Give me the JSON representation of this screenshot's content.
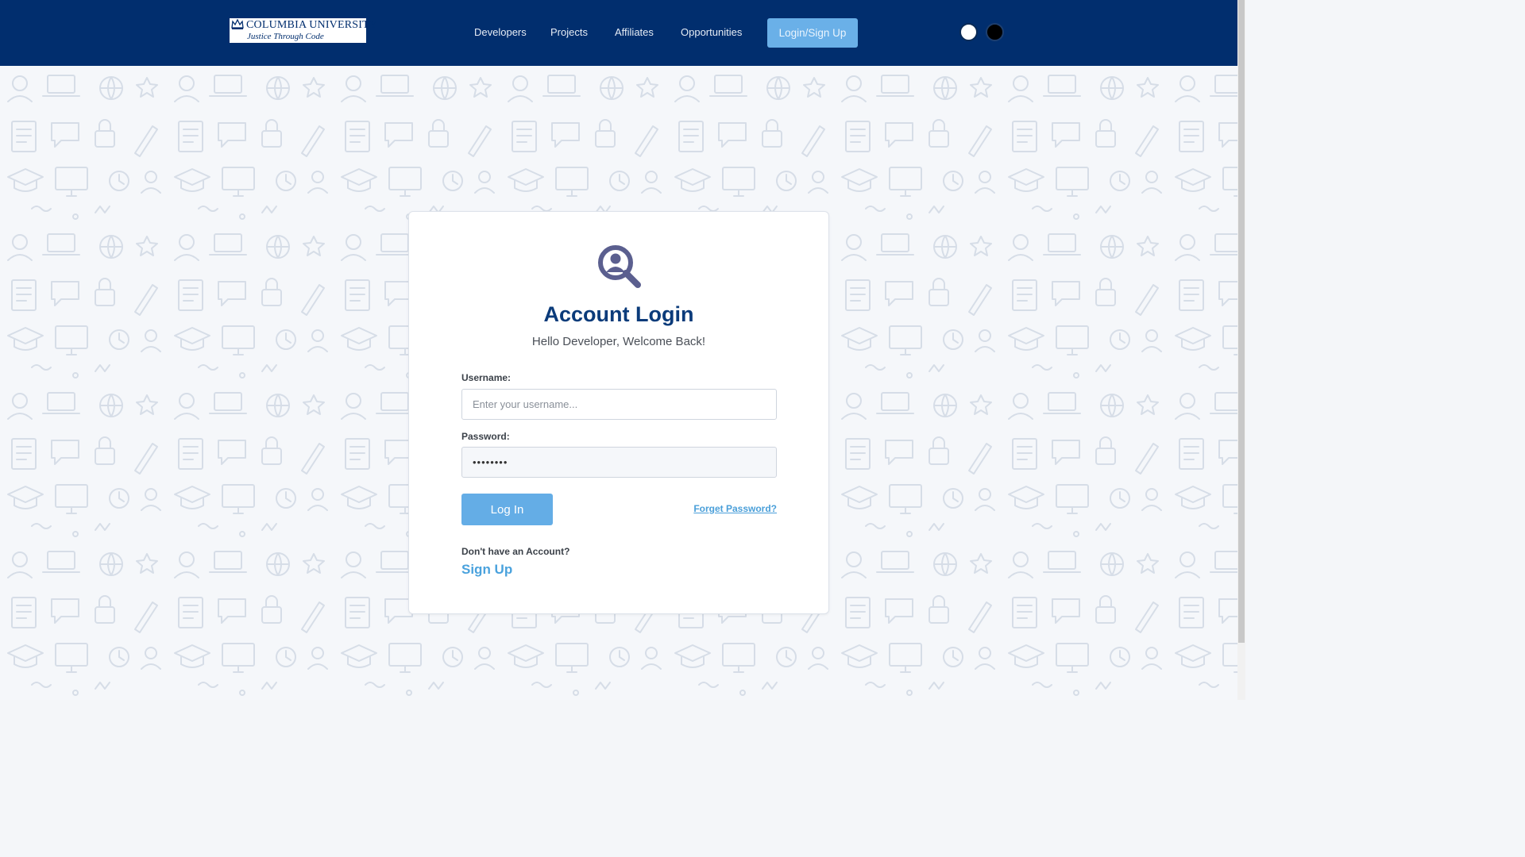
{
  "header": {
    "logo": {
      "line1": "COLUMBIA UNIVERSITY",
      "line2": "Justice Through Code",
      "icon": "crown-icon"
    },
    "nav": [
      {
        "label": "Developers"
      },
      {
        "label": "Projects"
      },
      {
        "label": "Affiliates"
      },
      {
        "label": "Opportunities"
      }
    ],
    "login_signup_label": "Login/Sign Up",
    "theme_toggles": [
      {
        "name": "light-theme-toggle",
        "color": "#ffffff"
      },
      {
        "name": "dark-theme-toggle",
        "color": "#000000"
      }
    ]
  },
  "login_card": {
    "icon": "user-search-icon",
    "title": "Account Login",
    "subtitle": "Hello Developer, Welcome Back!",
    "username": {
      "label": "Username:",
      "placeholder": "Enter your username...",
      "value": ""
    },
    "password": {
      "label": "Password:",
      "value": "••••••••"
    },
    "login_button": "Log In",
    "forgot_password": "Forget Password?",
    "no_account_text": "Don't have an Account?",
    "signup_link": "Sign Up"
  },
  "colors": {
    "header_bg": "#012e6e",
    "accent_blue": "#64ade6",
    "title_blue": "#0b3b7a",
    "link_blue": "#4aa2dd"
  }
}
